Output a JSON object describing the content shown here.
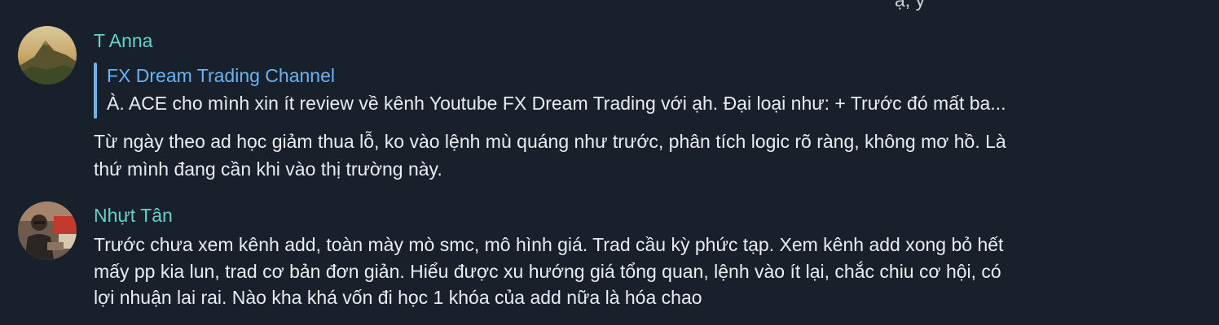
{
  "top_fragment": "ạ, y",
  "messages": [
    {
      "sender": "T Anna",
      "reply": {
        "title": "FX Dream Trading Channel",
        "text": "À. ACE cho mình xin ít review về kênh Youtube FX Dream Trading với ạh.  Đại loại như:  + Trước đó mất ba..."
      },
      "lines": [
        "Từ ngày theo ad học giảm thua lỗ, ko vào lệnh mù quáng như trước, phân tích logic rõ ràng, không mơ hồ. Là",
        "thứ mình đang cần khi vào thị trường này."
      ]
    },
    {
      "sender": "Nhựt Tân",
      "lines": [
        "Trước chưa xem kênh add, toàn mày mò smc, mô hình giá. Trad cầu kỳ phức tạp. Xem kênh add xong bỏ hết",
        "mấy pp kia lun, trad cơ bản đơn giản. Hiểu được xu hướng giá tổng quan, lệnh vào ít lại, chắc chiu cơ hội, có",
        "lợi nhuận lai rai. Nào kha khá vốn đi học 1 khóa của add nữa là hóa chao"
      ]
    }
  ],
  "colors": {
    "background": "#17202b",
    "sender_name": "#63d3c8",
    "reply_accent": "#6ab3f3",
    "text": "#e9edf1"
  }
}
